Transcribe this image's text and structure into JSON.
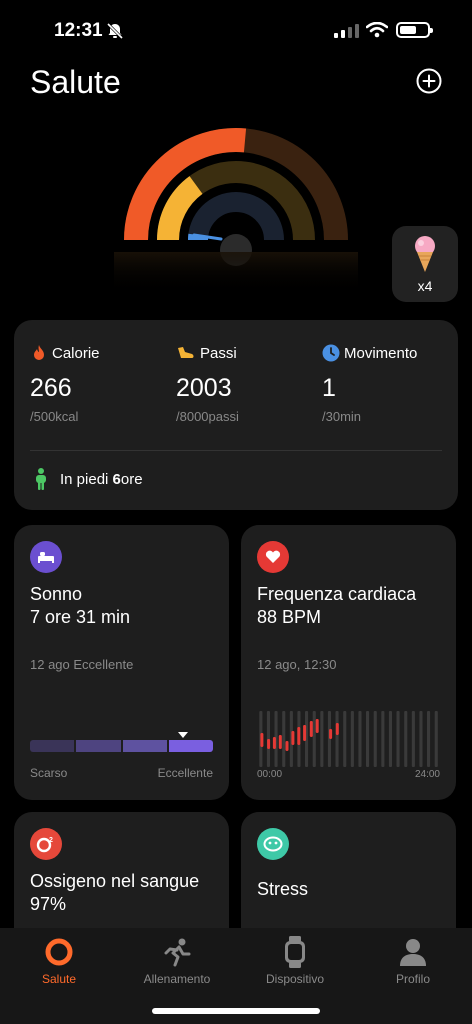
{
  "status": {
    "time": "12:31"
  },
  "header": {
    "title": "Salute"
  },
  "reward": {
    "count": "x4"
  },
  "summary": {
    "calories": {
      "label": "Calorie",
      "value": "266",
      "goal": "/500kcal"
    },
    "steps": {
      "label": "Passi",
      "value": "2003",
      "goal": "/8000passi"
    },
    "movement": {
      "label": "Movimento",
      "value": "1",
      "goal": "/30min"
    },
    "standing": {
      "prefix": "In piedi",
      "value": "6",
      "unit": "ore"
    }
  },
  "sleep": {
    "title": "Sonno",
    "value": "7 ore 31 min",
    "date": "12 ago Eccellente",
    "scale_low": "Scarso",
    "scale_high": "Eccellente"
  },
  "heart": {
    "title": "Frequenza cardiaca",
    "value": "88 BPM",
    "date": "12 ago, 12:30",
    "time_start": "00:00",
    "time_end": "24:00"
  },
  "oxygen": {
    "title": "Ossigeno nel sangue",
    "value": "97%"
  },
  "stress": {
    "title": "Stress"
  },
  "tabs": [
    {
      "label": "Salute",
      "icon": "ring-icon",
      "active": true
    },
    {
      "label": "Allenamento",
      "icon": "running-icon",
      "active": false
    },
    {
      "label": "Dispositivo",
      "icon": "watch-icon",
      "active": false
    },
    {
      "label": "Profilo",
      "icon": "person-icon",
      "active": false
    }
  ],
  "colors": {
    "calories": "#f05a28",
    "steps": "#f5b335",
    "movement": "#4a90e2",
    "standing": "#4cc764",
    "sleep": "#6b4fd0",
    "heart": "#e53935",
    "stress": "#3ec9a7",
    "accent": "#ff6a2b"
  }
}
